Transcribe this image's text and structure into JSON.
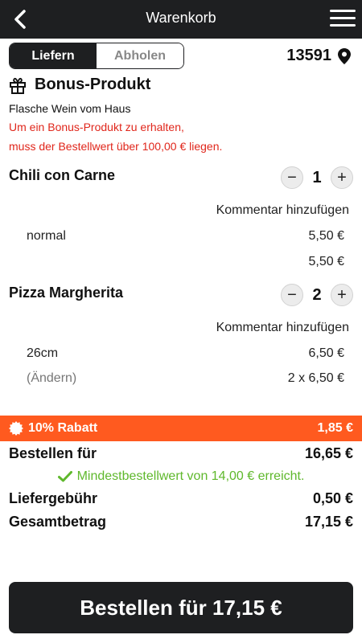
{
  "header": {
    "title": "Warenkorb"
  },
  "delivery_toggle": {
    "options": [
      "Liefern",
      "Abholen"
    ],
    "selected": "Liefern"
  },
  "postcode": "13591",
  "bonus": {
    "title": "Bonus-Produkt",
    "product": "Flasche Wein vom Haus",
    "notice_line1": "Um ein Bonus-Produkt zu erhalten,",
    "notice_line2": "muss der Bestellwert über 100,00 € liegen."
  },
  "items": [
    {
      "name": "Chili con Carne",
      "quantity": "1",
      "comment_label": "Kommentar hinzufügen",
      "option": "normal",
      "option_price": "5,50 €",
      "total": "5,50 €"
    },
    {
      "name": "Pizza Margherita",
      "quantity": "2",
      "comment_label": "Kommentar hinzufügen",
      "option": "26cm",
      "option_price": "6,50 €",
      "change_label": "(Ändern)",
      "total": "2 x 6,50 €"
    }
  ],
  "discount": {
    "label": "10% Rabatt",
    "value": "1,85 €",
    "color": "#ff5a1f"
  },
  "summary": {
    "order_for_label": "Bestellen für",
    "order_for_value": "16,65 €",
    "min_order_notice": "Mindestbestellwert von 14,00 € erreicht.",
    "delivery_fee_label": "Liefergebühr",
    "delivery_fee_value": "0,50 €",
    "total_label": "Gesamtbetrag",
    "total_value": "17,15 €"
  },
  "cta": {
    "label": "Bestellen für 17,15 €"
  },
  "quantity_controls": {
    "minus": "−",
    "plus": "+"
  },
  "icons": {
    "back": "chevron-left-icon",
    "menu": "hamburger-menu-icon",
    "location": "map-pin-icon",
    "gift": "gift-icon",
    "discount": "badge-icon",
    "check": "check-icon"
  },
  "colors": {
    "dark": "#1e1f21",
    "accent_red": "#e0261b",
    "success_green": "#5fb82c"
  }
}
